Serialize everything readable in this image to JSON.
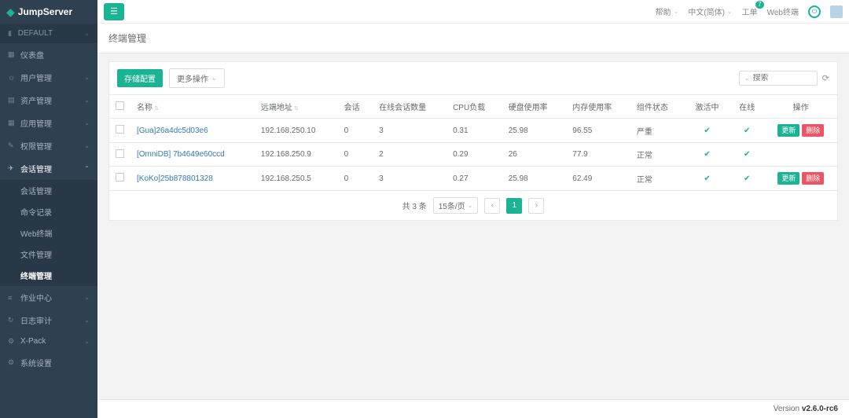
{
  "brand": "JumpServer",
  "org": "DEFAULT",
  "sidebar": {
    "items": [
      {
        "label": "仪表盘"
      },
      {
        "label": "用户管理"
      },
      {
        "label": "资产管理"
      },
      {
        "label": "应用管理"
      },
      {
        "label": "权限管理"
      },
      {
        "label": "会话管理"
      },
      {
        "label": "作业中心"
      },
      {
        "label": "日志审计"
      },
      {
        "label": "X-Pack"
      },
      {
        "label": "系统设置"
      }
    ],
    "sub_session": [
      {
        "label": "会话管理"
      },
      {
        "label": "命令记录"
      },
      {
        "label": "Web终端"
      },
      {
        "label": "文件管理"
      },
      {
        "label": "终端管理"
      }
    ]
  },
  "topbar": {
    "help": "帮助",
    "lang": "中文(简体)",
    "ticket": "工单",
    "ticket_count": "7",
    "web_terminal": "Web终端"
  },
  "page": {
    "title": "终端管理"
  },
  "toolbar": {
    "storage_btn": "存储配置",
    "more_btn": "更多操作"
  },
  "search": {
    "placeholder": "搜索"
  },
  "table": {
    "headers": {
      "name": "名称",
      "remote_addr": "远端地址",
      "sessions": "会话",
      "online_sessions": "在线会话数量",
      "cpu": "CPU负载",
      "disk": "硬盘使用率",
      "memory": "内存使用率",
      "component": "组件状态",
      "active": "激活中",
      "online": "在线",
      "actions": "操作"
    },
    "rows": [
      {
        "name": "[Gua]26a4dc5d03e6",
        "remote_addr": "192.168.250.10",
        "sessions": "0",
        "online_sessions": "3",
        "cpu": "0.31",
        "disk": "25.98",
        "memory": "96.55",
        "component": "严重",
        "active": true,
        "online": true,
        "update": "更新",
        "delete": "删除"
      },
      {
        "name": "[OmniDB] 7b4649e60ccd",
        "remote_addr": "192.168.250.9",
        "sessions": "0",
        "online_sessions": "2",
        "cpu": "0.29",
        "disk": "26",
        "memory": "77.9",
        "component": "正常",
        "active": true,
        "online": true
      },
      {
        "name": "[KoKo]25b878801328",
        "remote_addr": "192.168.250.5",
        "sessions": "0",
        "online_sessions": "3",
        "cpu": "0.27",
        "disk": "25.98",
        "memory": "62.49",
        "component": "正常",
        "active": true,
        "online": true,
        "update": "更新",
        "delete": "删除"
      }
    ]
  },
  "pagination": {
    "total_text": "共 3 条",
    "page_size": "15条/页",
    "current": "1"
  },
  "footer": {
    "version_label": "Version",
    "version": "v2.6.0-rc6"
  }
}
